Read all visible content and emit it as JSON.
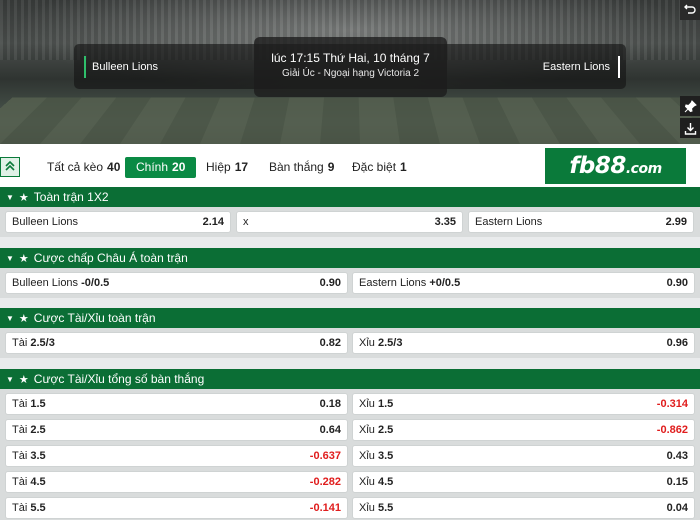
{
  "match": {
    "home_team": "Bulleen Lions",
    "away_team": "Eastern Lions",
    "time": "lúc 17:15 Thứ Hai, 10 tháng 7",
    "league": "Giải Úc - Ngoại hạng Victoria 2"
  },
  "side_icons": [
    "back-arrow-icon",
    "pin-icon",
    "download-icon"
  ],
  "tabs": [
    {
      "label": "Tất cả kèo",
      "count": "40",
      "active": false
    },
    {
      "label": "Chính",
      "count": "20",
      "active": true
    },
    {
      "label": "Hiệp",
      "count": "17",
      "active": false
    },
    {
      "label": "Bàn thắng",
      "count": "9",
      "active": false
    },
    {
      "label": "Đặc biệt",
      "count": "1",
      "active": false
    }
  ],
  "logo": {
    "main": "fb88",
    "suffix": ".com"
  },
  "colors": {
    "accent": "#0a8a44",
    "header": "#0b6e35",
    "negative": "#e01d1d"
  },
  "sections": {
    "s1x2": {
      "title": "Toàn trận 1X2",
      "odds": [
        {
          "label": "Bulleen Lions",
          "handicap": "",
          "value": "2.14"
        },
        {
          "label": "x",
          "handicap": "",
          "value": "3.35"
        },
        {
          "label": "Eastern Lions",
          "handicap": "",
          "value": "2.99"
        }
      ]
    },
    "asian": {
      "title": "Cược chấp Châu Á toàn trận",
      "odds": [
        {
          "label": "Bulleen Lions",
          "handicap": "-0/0.5",
          "value": "0.90"
        },
        {
          "label": "Eastern Lions",
          "handicap": "+0/0.5",
          "value": "0.90"
        }
      ]
    },
    "ou": {
      "title": "Cược Tài/Xỉu toàn trận",
      "odds": [
        {
          "label": "Tài",
          "handicap": "2.5/3",
          "value": "0.82"
        },
        {
          "label": "Xỉu",
          "handicap": "2.5/3",
          "value": "0.96"
        }
      ]
    },
    "total_goals": {
      "title": "Cược Tài/Xỉu tổng số bàn thắng",
      "rows": [
        {
          "over": {
            "label": "Tài",
            "line": "1.5",
            "value": "0.18"
          },
          "under": {
            "label": "Xỉu",
            "line": "1.5",
            "value": "-0.314"
          }
        },
        {
          "over": {
            "label": "Tài",
            "line": "2.5",
            "value": "0.64"
          },
          "under": {
            "label": "Xỉu",
            "line": "2.5",
            "value": "-0.862"
          }
        },
        {
          "over": {
            "label": "Tài",
            "line": "3.5",
            "value": "-0.637"
          },
          "under": {
            "label": "Xỉu",
            "line": "3.5",
            "value": "0.43"
          }
        },
        {
          "over": {
            "label": "Tài",
            "line": "4.5",
            "value": "-0.282"
          },
          "under": {
            "label": "Xỉu",
            "line": "4.5",
            "value": "0.15"
          }
        },
        {
          "over": {
            "label": "Tài",
            "line": "5.5",
            "value": "-0.141"
          },
          "under": {
            "label": "Xỉu",
            "line": "5.5",
            "value": "0.04"
          }
        }
      ]
    }
  }
}
